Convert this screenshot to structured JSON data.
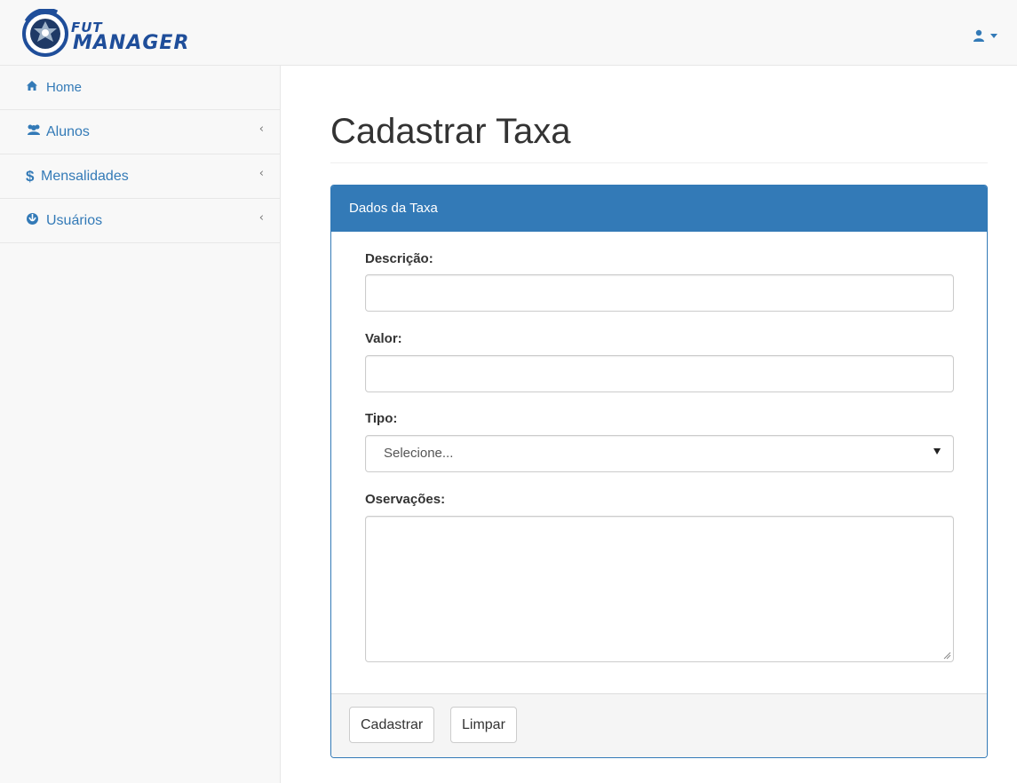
{
  "brand": {
    "line1": "FUT",
    "line2": "MANAGER"
  },
  "header": {
    "user_icon": "user-icon",
    "dropdown_icon": "caret-down-icon"
  },
  "sidebar": {
    "items": [
      {
        "label": "Home",
        "icon": "home-icon",
        "has_chevron": false
      },
      {
        "label": "Alunos",
        "icon": "users-icon",
        "has_chevron": true
      },
      {
        "label": "Mensalidades",
        "icon": "dollar-icon",
        "has_chevron": true
      },
      {
        "label": "Usuários",
        "icon": "rebel-icon",
        "has_chevron": true
      }
    ],
    "chevron": "‹"
  },
  "main": {
    "title": "Cadastrar Taxa"
  },
  "panel": {
    "heading": "Dados da Taxa",
    "fields": {
      "descricao": {
        "label": "Descrição:",
        "value": "",
        "placeholder": ""
      },
      "valor": {
        "label": "Valor:",
        "value": "",
        "placeholder": ""
      },
      "tipo": {
        "label": "Tipo:",
        "selected": "Selecione..."
      },
      "observacoes": {
        "label": "Oservações:",
        "value": ""
      }
    },
    "buttons": {
      "submit": "Cadastrar",
      "reset": "Limpar"
    }
  },
  "colors": {
    "primary": "#337ab7",
    "navbar_bg": "#f8f8f8",
    "brand_blue": "#1f4e9a"
  }
}
